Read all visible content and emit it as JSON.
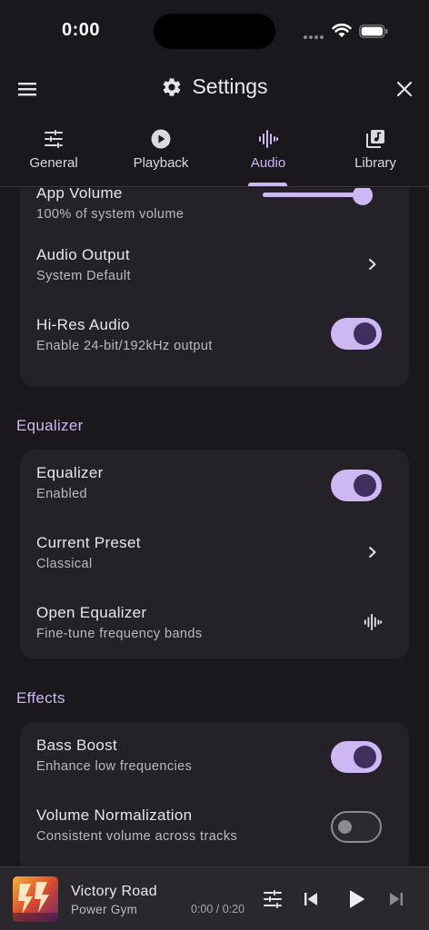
{
  "status_bar": {
    "time": "0:00"
  },
  "header": {
    "title": "Settings"
  },
  "tabs": [
    {
      "label": "General",
      "icon": "sliders-icon",
      "active": false
    },
    {
      "label": "Playback",
      "icon": "play-circle-icon",
      "active": false
    },
    {
      "label": "Audio",
      "icon": "waveform-icon",
      "active": true
    },
    {
      "label": "Library",
      "icon": "library-icon",
      "active": false
    }
  ],
  "audio": {
    "app_volume": {
      "title": "App Volume",
      "subtitle": "100% of system volume",
      "value": 1.0
    },
    "audio_output": {
      "title": "Audio Output",
      "subtitle": "System Default"
    },
    "hi_res": {
      "title": "Hi-Res Audio",
      "subtitle": "Enable 24-bit/192kHz output",
      "enabled": true
    }
  },
  "equalizer_section": {
    "label": "Equalizer",
    "equalizer": {
      "title": "Equalizer",
      "subtitle": "Enabled",
      "enabled": true
    },
    "preset": {
      "title": "Current Preset",
      "subtitle": "Classical"
    },
    "open": {
      "title": "Open Equalizer",
      "subtitle": "Fine-tune frequency bands"
    }
  },
  "effects_section": {
    "label": "Effects",
    "bass_boost": {
      "title": "Bass Boost",
      "subtitle": "Enhance low frequencies",
      "enabled": true
    },
    "normalization": {
      "title": "Volume Normalization",
      "subtitle": "Consistent volume across tracks",
      "enabled": false
    }
  },
  "player": {
    "title": "Victory Road",
    "artist": "Power Gym",
    "time": "0:00 / 0:20"
  },
  "colors": {
    "accent": "#cdb8f4",
    "background": "#1a181d",
    "card": "#242128"
  }
}
